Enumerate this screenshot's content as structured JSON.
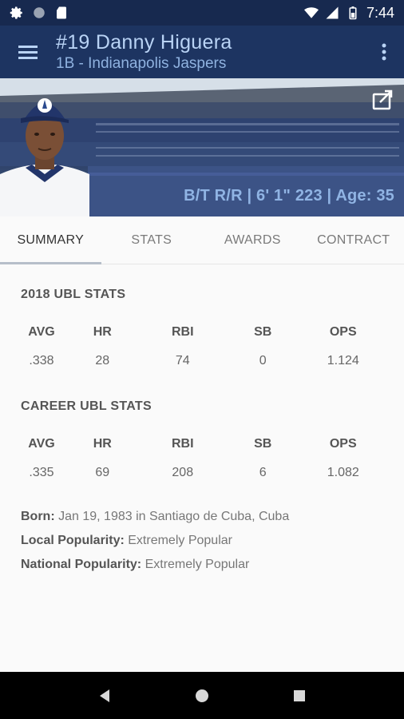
{
  "status_bar": {
    "time": "7:44"
  },
  "app_bar": {
    "title": "#19 Danny Higuera",
    "subtitle": "1B - Indianapolis Jaspers"
  },
  "hero": {
    "bio_line": "B/T R/R | 6' 1\" 223 | Age: 35"
  },
  "tabs": [
    {
      "label": "SUMMARY",
      "active": true
    },
    {
      "label": "STATS",
      "active": false
    },
    {
      "label": "AWARDS",
      "active": false
    },
    {
      "label": "CONTRACT",
      "active": false
    }
  ],
  "season_stats": {
    "title": "2018 UBL STATS",
    "headers": [
      "AVG",
      "HR",
      "RBI",
      "SB",
      "OPS"
    ],
    "values": [
      ".338",
      "28",
      "74",
      "0",
      "1.124"
    ]
  },
  "career_stats": {
    "title": "CAREER UBL STATS",
    "headers": [
      "AVG",
      "HR",
      "RBI",
      "SB",
      "OPS"
    ],
    "values": [
      ".335",
      "69",
      "208",
      "6",
      "1.082"
    ]
  },
  "info": {
    "born_label": "Born:",
    "born_value": "Jan 19, 1983 in Santiago de Cuba, Cuba",
    "local_label": "Local Popularity:",
    "local_value": "Extremely Popular",
    "national_label": "National Popularity:",
    "national_value": "Extremely Popular"
  },
  "colors": {
    "primary": "#1d3461",
    "status_bar": "#17294f",
    "title_text": "#b9d3f5",
    "bio_text": "#90b4e4",
    "tab_indicator": "#b6bec9"
  },
  "icons": {
    "status_left": [
      "gear-icon",
      "circle-icon",
      "sd-card-icon"
    ],
    "status_right": [
      "wifi-icon",
      "signal-icon",
      "battery-icon"
    ],
    "app_bar": [
      "hamburger-menu-icon",
      "more-vert-icon"
    ],
    "hero": [
      "share-icon"
    ],
    "nav": [
      "back-icon",
      "home-icon",
      "recents-icon"
    ]
  }
}
